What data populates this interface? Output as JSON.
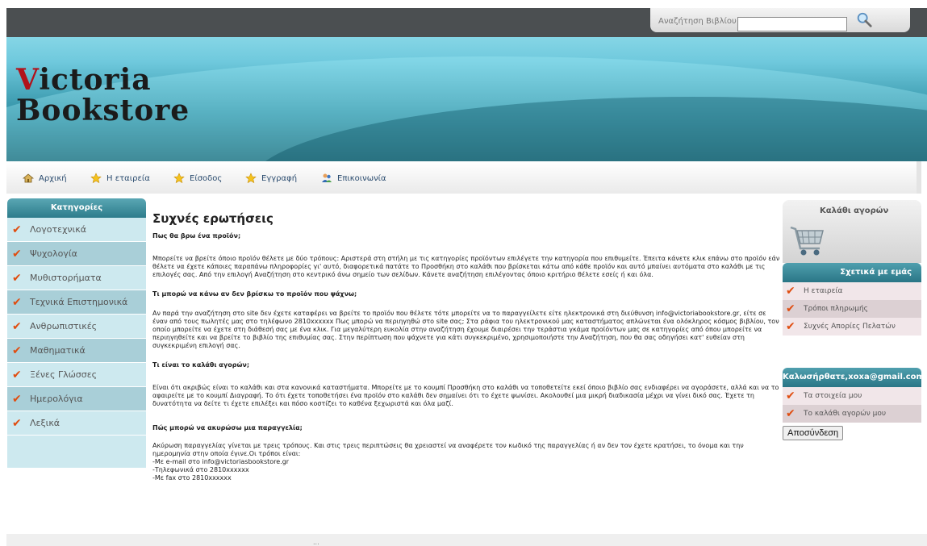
{
  "header": {
    "logo_line1_first": "V",
    "logo_line1_rest": "ictoria",
    "logo_line2": "Bookstore",
    "search_label": "Αναζήτηση Βιβλίου",
    "search_value": ""
  },
  "nav": {
    "items": [
      {
        "label": "Αρχική",
        "icon": "home-icon"
      },
      {
        "label": "Η εταιρεία",
        "icon": "star-icon"
      },
      {
        "label": "Είσοδος",
        "icon": "star-icon"
      },
      {
        "label": "Εγγραφή",
        "icon": "star-icon"
      },
      {
        "label": "Επικοινωνία",
        "icon": "contact-icon"
      }
    ]
  },
  "categories": {
    "title": "Κατηγορίες",
    "items": [
      "Λογοτεχνικά",
      "Ψυχολογία",
      "Μυθιστορήματα",
      "Τεχνικά Επιστημονικά",
      "Ανθρωπιστικές",
      "Μαθηματικά",
      "Ξένες Γλώσσες",
      "Ημερολόγια",
      "Λεξικά"
    ]
  },
  "faq": {
    "title": "Συχνές ερωτήσεις",
    "items": [
      {
        "q": "Πως θα βρω ένα προϊόν;",
        "a": "Μπορείτε να βρείτε όποιο προϊόν θέλετε με δύο τρόπους: Αριστερά στη στήλη με τις κατηγορίες προϊόντων επιλέγετε την κατηγορία που επιθυμείτε. Έπειτα κάνετε κλικ επάνω στο προϊόν εάν θέλετε να έχετε κάποιες παραπάνω πληροφορίες γι' αυτό, διαφορετικά πατάτε το Προσθήκη στο καλάθι που βρίσκεται κάτω από κάθε προϊόν και αυτό μπαίνει αυτόματα στο καλάθι με τις επιλογές σας. Από την επιλογή Αναζήτηση στο κεντρικό άνω σημείο των σελίδων. Κάνετε αναζήτηση επιλέγοντας όποιο κριτήριο θέλετε εσείς ή και όλα."
      },
      {
        "q": "Τι μπορώ να κάνω αν δεν βρίσκω το προϊόν που ψάχνω;",
        "a": " Αν παρά την αναζήτηση στο site δεν έχετε καταφέρει να βρείτε το προϊόν που θέλετε τότε μπορείτε να το παραγγείλετε είτε ηλεκτρονικά στη διεύθυνση info@victoriabookstore.gr, είτε σε έναν από τους πωλητές μας στο τηλέφωνο 2810xxxxxx Πως μπορώ να περιηγηθώ στο site σας; Στα ράφια του ηλεκτρονικού μας καταστήματος απλώνεται ένα ολόκληρος κόσμος βιβλίου, τον οποίο μπορείτε να έχετε στη διάθεσή σας με ένα κλικ. Για μεγαλύτερη ευκολία στην αναζήτηση έχουμε διαιρέσει την τεράστια γκάμα προϊόντων μας σε κατηγορίες από όπου μπορείτε να περιηγηθείτε και να βρείτε το βιβλίο της επιθυμίας σας. Στην περίπτωση που ψάχνετε για κάτι συγκεκριμένο, χρησιμοποιήστε την Αναζήτηση, που θα σας οδηγήσει κατ' ευθείαν στη συγκεκριμένη επιλογή σας."
      },
      {
        "q": "Τι είναι το καλάθι αγορών;",
        "a": " Είναι ότι ακριβώς είναι το καλάθι και στα κανονικά καταστήματα. Μπορείτε με το κουμπί Προσθήκη στο καλάθι να τοποθετείτε εκεί όποιο βιβλίο σας ενδιαφέρει να αγοράσετε, αλλά και να το αφαιρείτε με το κουμπί Διαγραφή. Το ότι έχετε τοποθετήσει ένα προϊόν στο καλάθι δεν σημαίνει ότι το έχετε ψωνίσει. Ακολουθεί μια μικρή διαδικασία μέχρι να γίνει δικό σας. Έχετε τη δυνατότητα να δείτε τι έχετε επιλέξει και πόσο κοστίζει το καθένα ξεχωριστά και όλα μαζί."
      },
      {
        "q": "Πώς μπορώ να ακυρώσω μια παραγγελία;",
        "a": " Ακύρωση παραγγελίας γίνεται με τρεις τρόπους. Και στις τρεις περιπτώσεις θα χρειαστεί να αναφέρετε τον κωδικό της παραγγελίας ή αν δεν τον έχετε κρατήσει, το όνομα και την ημερομηνία στην οποία έγινε.Οι τρόποι είναι:\n-Με e-mail στο info@victoriasbookstore.gr\n-Τηλεφωνικά στο 2810xxxxxx\n-Με fax στο 2810xxxxxx"
      }
    ]
  },
  "cart": {
    "title": "Καλάθι αγορών",
    "icon": "shopping-cart-icon"
  },
  "about": {
    "title": "Σχετικά με εμάς",
    "items": [
      "Η εταιρεία",
      "Τρόποι πληρωμής",
      "Συχνές Απορίες Πελατών"
    ]
  },
  "user": {
    "welcome": "Καλωσήρθατε,xoxa@gmail.com",
    "items": [
      "Τα στοιχεία μου",
      "Το καλάθι αγορών μου"
    ],
    "logout_label": "Αποσύνδεση"
  },
  "footer": {
    "text": "..."
  },
  "colors": {
    "accent_teal": "#2d7c8b",
    "tick_orange": "#e04d10",
    "logo_red": "#b1121b"
  }
}
